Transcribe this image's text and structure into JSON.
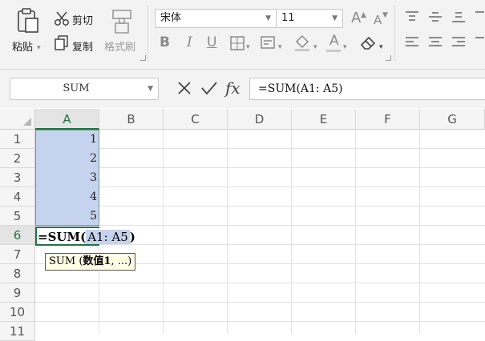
{
  "ribbon": {
    "paste_label": "粘贴",
    "cut_label": "剪切",
    "copy_label": "复制",
    "format_painter_label": "格式刷",
    "font_name": "宋体",
    "font_size": "11",
    "bold_glyph": "B",
    "italic_glyph": "I",
    "underline_glyph": "U",
    "font_color_glyph": "A",
    "grow_glyph": "A",
    "shrink_glyph": "A",
    "icons": [
      "paste-icon",
      "cut-icon",
      "copy-icon",
      "format-painter-icon",
      "grow-font-icon",
      "shrink-font-icon",
      "bold-icon",
      "italic-icon",
      "underline-icon",
      "border-icon",
      "fill-icon",
      "font-color-icon",
      "eraser-icon",
      "align-top-icon",
      "align-middle-icon",
      "align-bottom-icon",
      "align-left-icon",
      "align-center-icon",
      "align-right-icon"
    ]
  },
  "formula_bar": {
    "name_box": "SUM",
    "fx_label": "fx",
    "formula": "=SUM(A1: A5)"
  },
  "grid": {
    "columns": [
      "A",
      "B",
      "C",
      "D",
      "E",
      "F",
      "G"
    ],
    "rows": [
      "1",
      "2",
      "3",
      "4",
      "5",
      "6",
      "7",
      "8",
      "9",
      "10",
      "11"
    ],
    "active_column": "A",
    "active_row": "6",
    "values": [
      "1",
      "2",
      "3",
      "4",
      "5"
    ],
    "editing": {
      "prefix": "=SUM(",
      "ref": "A1: A5",
      "suffix": ")"
    },
    "tooltip": {
      "func": "SUM",
      "open": " (",
      "arg": "数值1",
      "rest": ", ...)"
    }
  },
  "colors": {
    "accent": "#217346",
    "selection": "#c6d3ef",
    "tooltip_bg": "#ffffe6"
  }
}
